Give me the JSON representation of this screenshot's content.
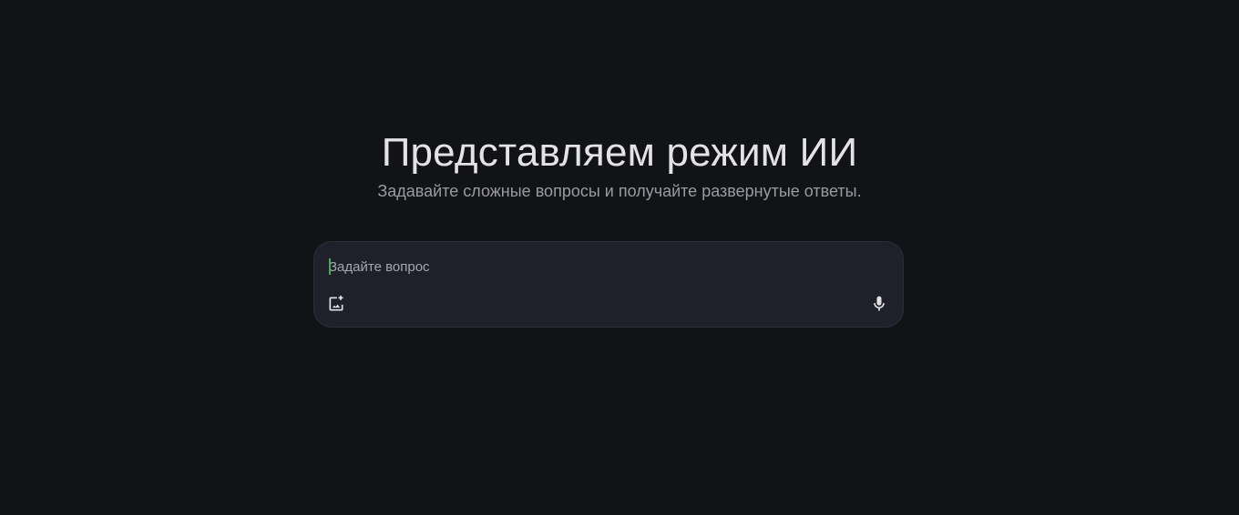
{
  "hero": {
    "title": "Представляем режим ИИ",
    "subtitle": "Задавайте сложные вопросы и получайте развернутые ответы."
  },
  "prompt": {
    "placeholder": "Задайте вопрос",
    "value": "",
    "icons": {
      "left": "add-image-icon",
      "right": "microphone-icon"
    }
  },
  "colors": {
    "background": "#121317",
    "box": "#1f2029",
    "caret": "#3fae5a",
    "text": "#e3e3e6"
  }
}
